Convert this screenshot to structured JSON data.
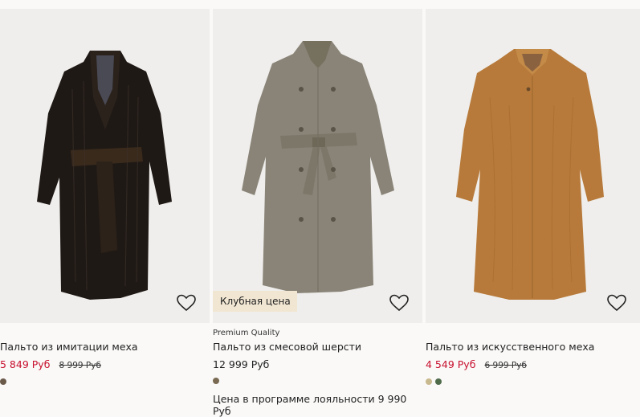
{
  "products": [
    {
      "tag": "",
      "title": "Пальто из имитации меха",
      "price": "5 849 Руб",
      "old_price": "8 999 Руб",
      "price_is_sale": true,
      "swatch_colors": [
        "#6b5a4a"
      ],
      "coat_color": "#1f1915",
      "favorite_icon": "heart-outline-icon"
    },
    {
      "tag": "Premium Quality",
      "title": "Пальто из смесовой шерсти",
      "price": "12 999 Руб",
      "badge": "Клубная цена",
      "loyalty_text": "Цена в программе лояльности 9 990 Руб",
      "swatch_colors": [
        "#7a6a52"
      ],
      "coat_color": "#8a8478",
      "favorite_icon": "heart-outline-icon"
    },
    {
      "tag": "",
      "title": "Пальто из искусственного меха",
      "price": "4 549 Руб",
      "old_price": "6 999 Руб",
      "price_is_sale": true,
      "swatch_colors": [
        "#c9b98e",
        "#4f6b4a"
      ],
      "coat_color": "#b77a3a",
      "favorite_icon": "heart-outline-icon"
    }
  ]
}
